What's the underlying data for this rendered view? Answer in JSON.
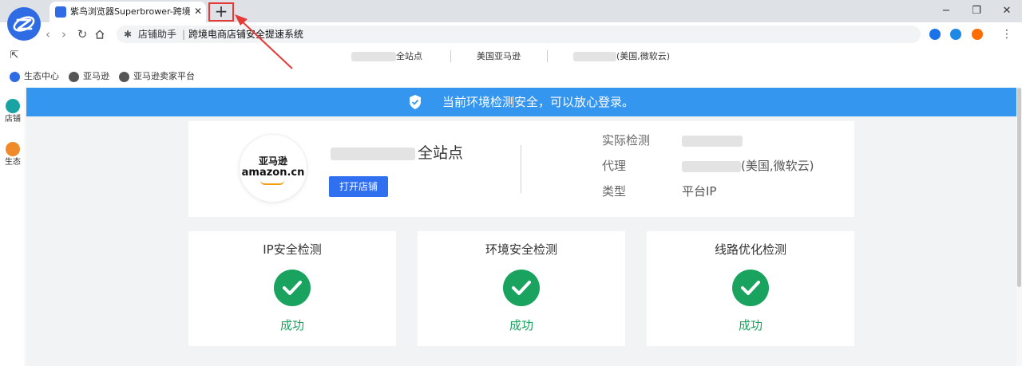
{
  "browser": {
    "tab_title": "紫鸟浏览器Superbrower-跨境电商",
    "tab_close": "✕",
    "new_tab": "+",
    "win_minimize": "−",
    "win_maximize": "❐",
    "win_close": "✕",
    "address_site": "店铺助手",
    "address_separator": "|",
    "address_page": "跨境电商店铺安全提速系统",
    "menu": "⋮"
  },
  "bookmarks": {
    "top": {
      "site_suffix": "全站点",
      "marketplace": "美国亚马逊",
      "region": "(美国,微软云)"
    },
    "bottom": [
      {
        "label": "生态中心",
        "icon": "ziniao-logo-icon"
      },
      {
        "label": "亚马逊",
        "icon": "globe-icon"
      },
      {
        "label": "亚马逊卖家平台",
        "icon": "globe-icon"
      }
    ]
  },
  "left_rail": [
    {
      "label": "店铺",
      "icon": "store-icon",
      "color": "#1aa3a3"
    },
    {
      "label": "生态",
      "icon": "ecosystem-icon",
      "color": "#f0892a"
    }
  ],
  "banner": {
    "text": "当前环境检测安全，可以放心登录。",
    "icon": "shield-check-icon",
    "color": "#3596f0"
  },
  "store": {
    "logo_cn": "亚马逊",
    "logo_en": "amazon.cn",
    "name_suffix": "全站点",
    "open_button": "打开店铺",
    "info": [
      {
        "label": "实际检测",
        "value": ""
      },
      {
        "label": "代理",
        "value": "(美国,微软云)"
      },
      {
        "label": "类型",
        "value": "平台IP"
      }
    ]
  },
  "checks": [
    {
      "title": "IP安全检测",
      "status": "成功"
    },
    {
      "title": "环境安全检测",
      "status": "成功"
    },
    {
      "title": "线路优化检测",
      "status": "成功"
    }
  ],
  "colors": {
    "accent": "#2f6ff0",
    "success": "#19a35e",
    "annotation": "#e53935"
  }
}
